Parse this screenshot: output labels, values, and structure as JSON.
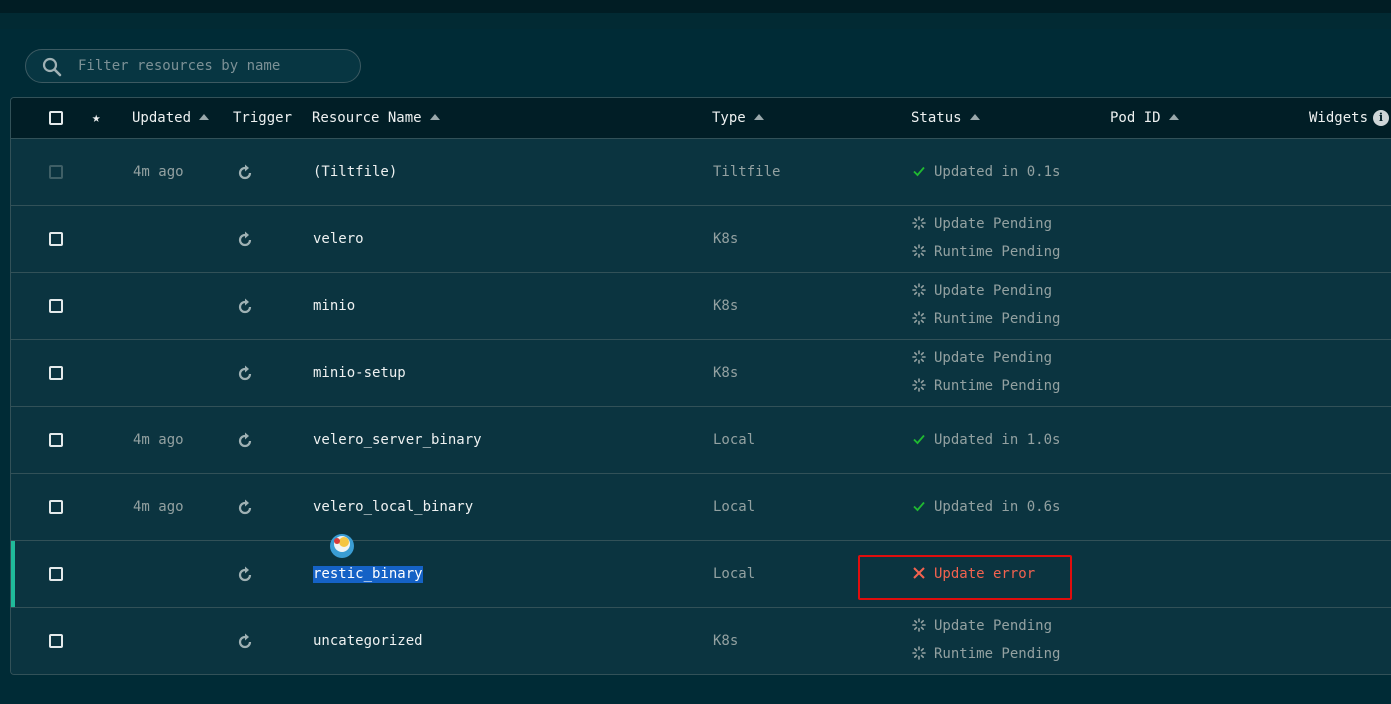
{
  "search": {
    "placeholder": "Filter resources by name",
    "icon": "search-icon"
  },
  "columns": {
    "updated": "Updated",
    "trigger": "Trigger",
    "resource_name": "Resource Name",
    "type": "Type",
    "status": "Status",
    "pod_id": "Pod ID",
    "widgets": "Widgets",
    "star": "★",
    "info": "i"
  },
  "rows": [
    {
      "updated": "4m ago",
      "name": "(Tiltfile)",
      "type": "Tiltfile",
      "status": [
        "Updated in 0.1s"
      ],
      "state": "ok",
      "checkbox_disabled": true
    },
    {
      "updated": "",
      "name": "velero",
      "type": "K8s",
      "status": [
        "Update Pending",
        "Runtime Pending"
      ],
      "state": "pending"
    },
    {
      "updated": "",
      "name": "minio",
      "type": "K8s",
      "status": [
        "Update Pending",
        "Runtime Pending"
      ],
      "state": "pending"
    },
    {
      "updated": "",
      "name": "minio-setup",
      "type": "K8s",
      "status": [
        "Update Pending",
        "Runtime Pending"
      ],
      "state": "pending"
    },
    {
      "updated": "4m ago",
      "name": "velero_server_binary",
      "type": "Local",
      "status": [
        "Updated in 1.0s"
      ],
      "state": "ok"
    },
    {
      "updated": "4m ago",
      "name": "velero_local_binary",
      "type": "Local",
      "status": [
        "Updated in 0.6s"
      ],
      "state": "ok"
    },
    {
      "updated": "",
      "name": "restic_binary",
      "type": "Local",
      "status": [
        "Update error"
      ],
      "state": "error",
      "selected": true
    },
    {
      "updated": "",
      "name": "uncategorized",
      "type": "K8s",
      "status": [
        "Update Pending",
        "Runtime Pending"
      ],
      "state": "pending"
    }
  ],
  "colors": {
    "accent": "#20ba9a",
    "error": "#f2624f",
    "ok": "#20ba31",
    "highlight": "#1562c6"
  }
}
